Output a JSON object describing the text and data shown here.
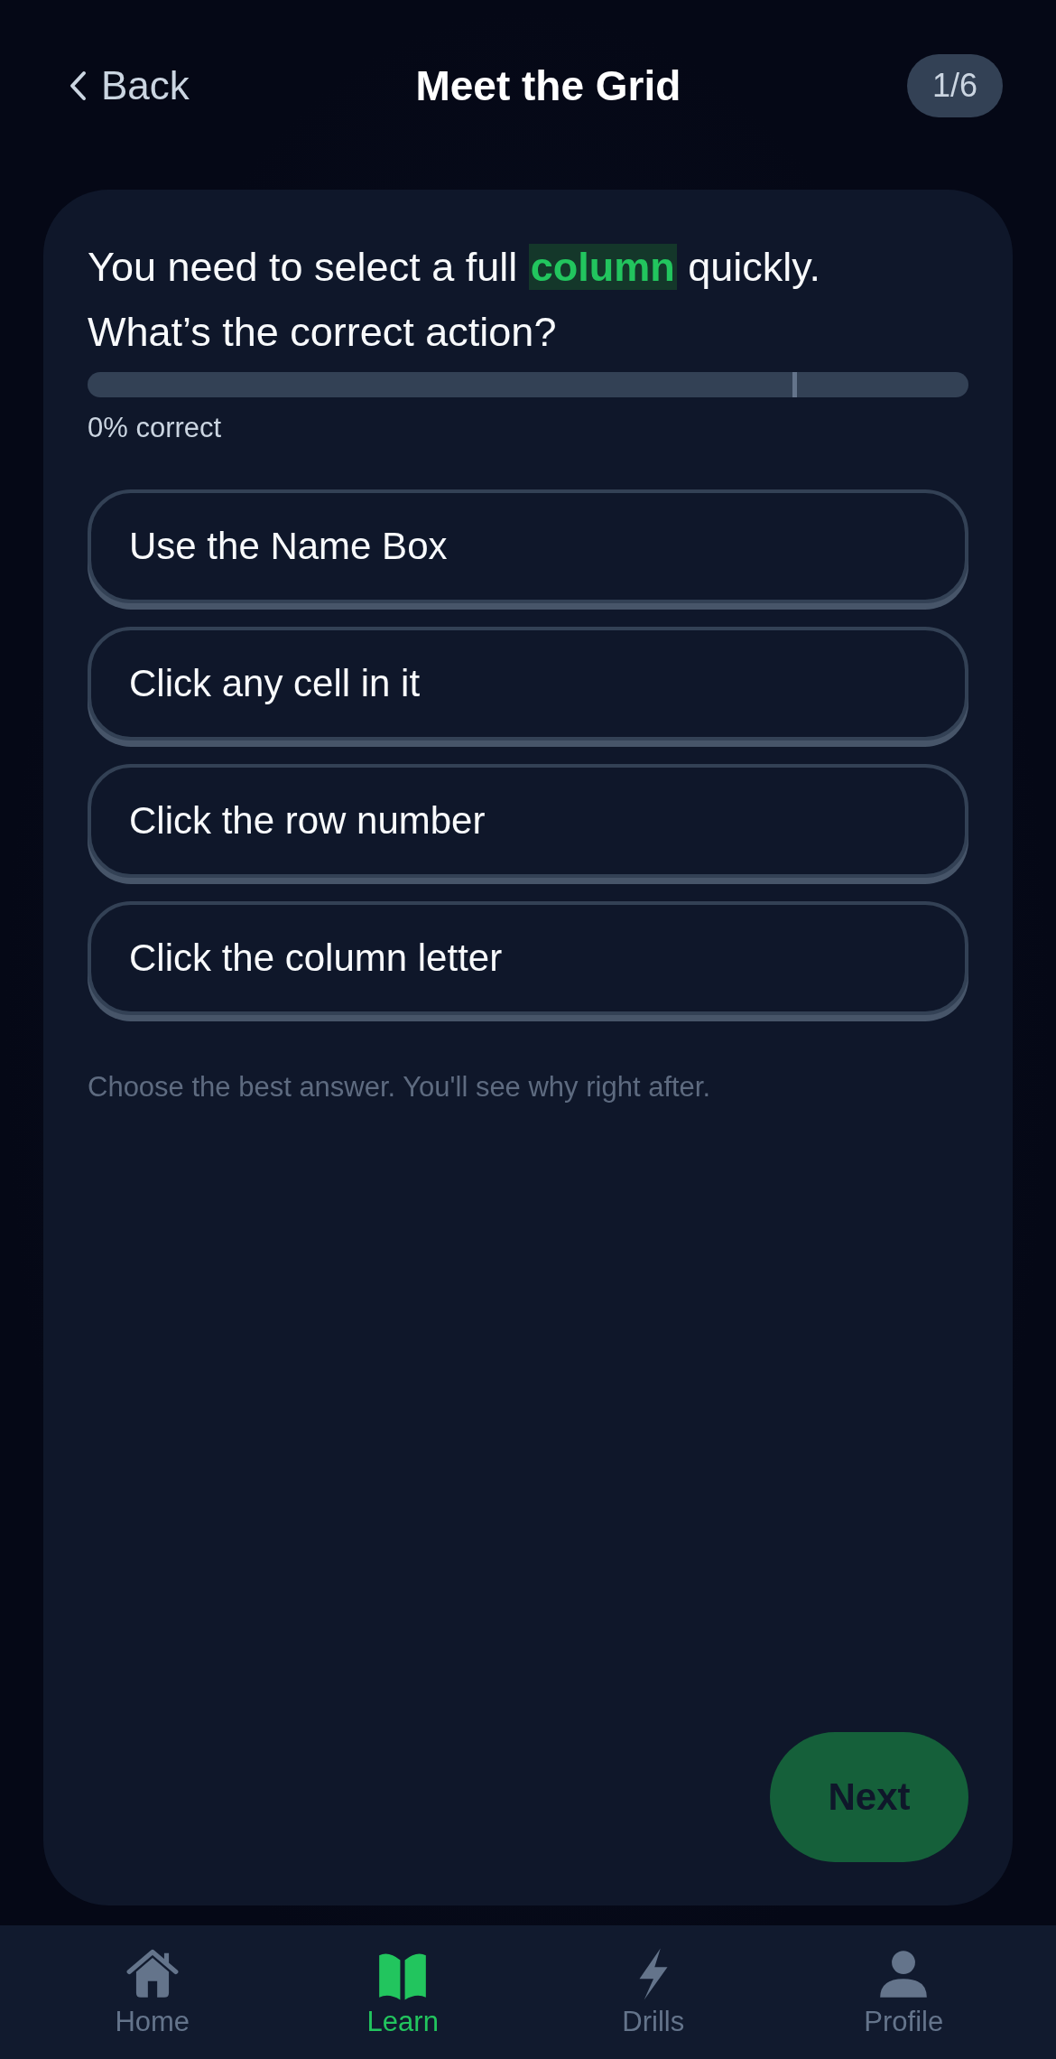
{
  "header": {
    "back": "Back",
    "title": "Meet the Grid",
    "step": "1/6"
  },
  "question": {
    "text": "You need to select a full **column** quickly. What’s the correct action?"
  },
  "progress": {
    "level": 0,
    "label": "0% correct",
    "marker": {
      "level": 0.8
    }
  },
  "options": [
    {
      "label": "Use the Name Box",
      "selected": false
    },
    {
      "label": "Click any cell in it",
      "selected": false
    },
    {
      "label": "Click the row number",
      "selected": false
    },
    {
      "label": "Click the column letter",
      "selected": false
    }
  ],
  "hint": "Choose the best answer. You'll see why right after.",
  "next": {
    "label": "Next",
    "disabled": true
  },
  "nav": [
    {
      "kind": "home",
      "label": "Home",
      "selected": false
    },
    {
      "kind": "learn",
      "label": "Learn",
      "selected": true
    },
    {
      "kind": "drills",
      "label": "Drills",
      "selected": false
    },
    {
      "kind": "profile",
      "label": "Profile",
      "selected": false
    }
  ]
}
